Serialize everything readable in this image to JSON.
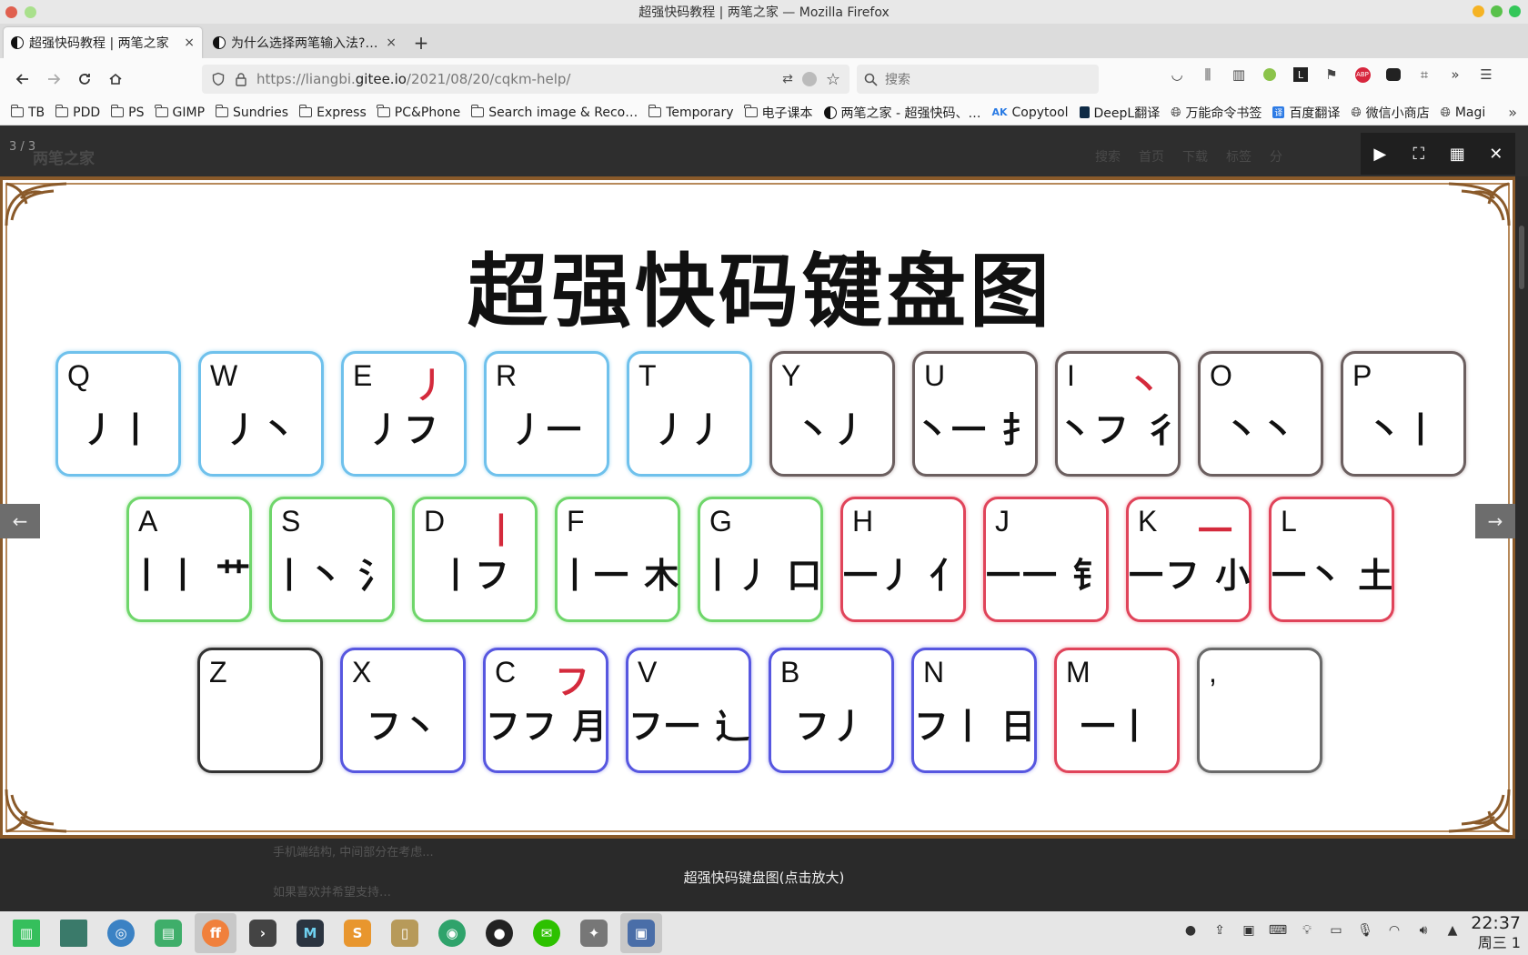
{
  "window": {
    "title": "超强快码教程 | 两笔之家 — Mozilla Firefox",
    "colors": {
      "close": "#f5b324",
      "min": "#58c14a",
      "max": "#22c55e"
    }
  },
  "tabs": [
    {
      "label": "超强快码教程 | 两笔之家",
      "close": "×"
    },
    {
      "label": "为什么选择两笔输入法? | 两",
      "close": "×"
    }
  ],
  "newtab": "+",
  "nav": {
    "url_prefix": "https://liangbi.",
    "url_domain": "gitee.io",
    "url_path": "/2021/08/20/cqkm-help/",
    "search_placeholder": "搜索"
  },
  "bookmarks": [
    "TB",
    "PDD",
    "PS",
    "GIMP",
    "Sundries",
    "Express",
    "PC&Phone",
    "Search image & Reco…",
    "Temporary",
    "电子课本",
    "两笔之家 - 超强快码、…",
    "Copytool",
    "DeepL翻译",
    "万能命令书签",
    "百度翻译",
    "微信小商店",
    "Magi"
  ],
  "viewer": {
    "counter": "3 / 3",
    "ghost_site": "两笔之家",
    "ghost_nav": [
      "搜索",
      "首页",
      "下载",
      "标签",
      "分"
    ],
    "caption": "超强快码键盘图(点击放大)",
    "ghost_line1": "手机端结构, 中间部分在考虑...",
    "ghost_line2": "如果喜欢并希望支持…"
  },
  "keyboard": {
    "title": "超强快码键盘图",
    "rows": [
      [
        {
          "letter": "Q",
          "strokes": "丿丨",
          "accent": "",
          "color": "blue"
        },
        {
          "letter": "W",
          "strokes": "丿丶",
          "accent": "",
          "color": "blue"
        },
        {
          "letter": "E",
          "strokes": "丿フ",
          "accent": "丿",
          "color": "blue"
        },
        {
          "letter": "R",
          "strokes": "丿一",
          "accent": "",
          "color": "blue"
        },
        {
          "letter": "T",
          "strokes": "丿丿",
          "accent": "",
          "color": "blue"
        },
        {
          "letter": "Y",
          "strokes": "丶丿",
          "accent": "",
          "color": "gray"
        },
        {
          "letter": "U",
          "strokes": "丶一 扌",
          "accent": "",
          "color": "gray"
        },
        {
          "letter": "I",
          "strokes": "丶フ 彳",
          "accent": "丶",
          "color": "gray"
        },
        {
          "letter": "O",
          "strokes": "丶丶",
          "accent": "",
          "color": "gray"
        },
        {
          "letter": "P",
          "strokes": "丶丨",
          "accent": "",
          "color": "gray"
        }
      ],
      [
        {
          "letter": "A",
          "strokes": "丨丨 艹",
          "accent": "",
          "color": "green"
        },
        {
          "letter": "S",
          "strokes": "丨丶 氵",
          "accent": "",
          "color": "green"
        },
        {
          "letter": "D",
          "strokes": "丨フ",
          "accent": "丨",
          "color": "green"
        },
        {
          "letter": "F",
          "strokes": "丨一 木",
          "accent": "",
          "color": "green"
        },
        {
          "letter": "G",
          "strokes": "丨丿 口",
          "accent": "",
          "color": "green"
        },
        {
          "letter": "H",
          "strokes": "一丿 亻",
          "accent": "",
          "color": "red"
        },
        {
          "letter": "J",
          "strokes": "一一 钅",
          "accent": "",
          "color": "red"
        },
        {
          "letter": "K",
          "strokes": "一フ 小",
          "accent": "一",
          "color": "red"
        },
        {
          "letter": "L",
          "strokes": "一丶 土",
          "accent": "",
          "color": "red"
        }
      ],
      [
        {
          "letter": "Z",
          "strokes": "",
          "accent": "",
          "color": "black"
        },
        {
          "letter": "X",
          "strokes": "フ丶",
          "accent": "",
          "color": "purple"
        },
        {
          "letter": "C",
          "strokes": "フフ 月",
          "accent": "フ",
          "color": "purple"
        },
        {
          "letter": "V",
          "strokes": "フ一 辶",
          "accent": "",
          "color": "purple"
        },
        {
          "letter": "B",
          "strokes": "フ丿",
          "accent": "",
          "color": "purple"
        },
        {
          "letter": "N",
          "strokes": "フ丨 日",
          "accent": "",
          "color": "purple"
        },
        {
          "letter": "M",
          "strokes": "一丨",
          "accent": "",
          "color": "red"
        },
        {
          "letter": ",",
          "strokes": "",
          "accent": "",
          "color": "darkgray"
        }
      ]
    ]
  },
  "taskbar": {
    "clock_time": "22:37",
    "clock_day": "周三 1"
  }
}
